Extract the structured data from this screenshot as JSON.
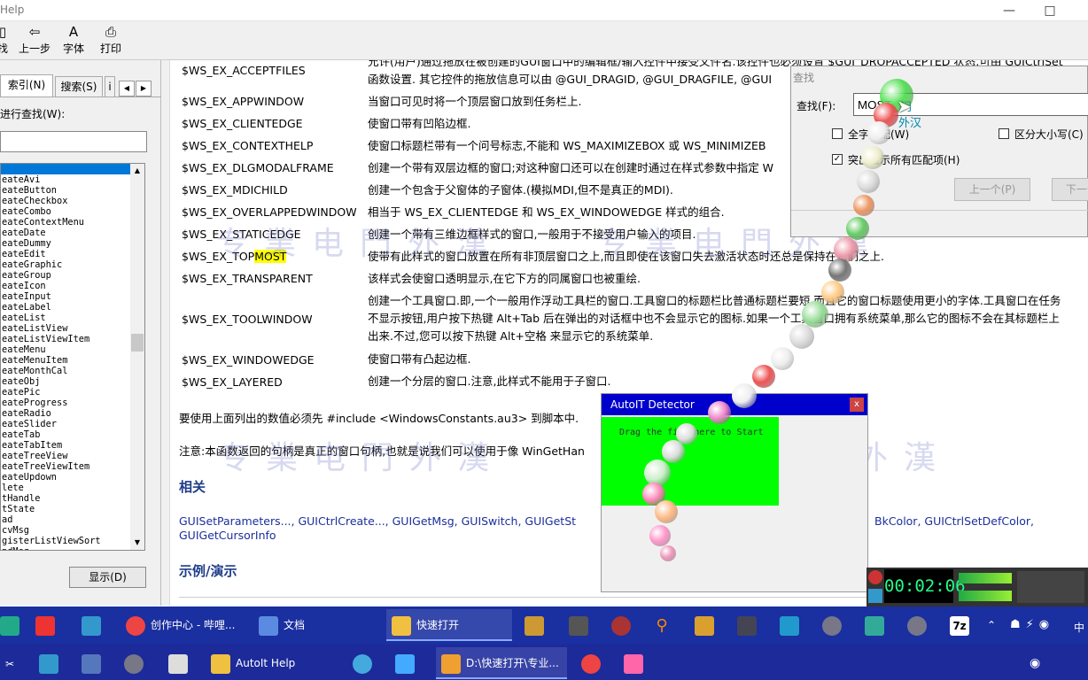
{
  "window": {
    "title": "Help",
    "minimize": "—",
    "maximize": "□"
  },
  "toolbar": {
    "buttons": [
      {
        "label": "找",
        "icon": "locate-icon"
      },
      {
        "label": "上一步",
        "icon": "back-icon"
      },
      {
        "label": "字体",
        "icon": "font-icon"
      },
      {
        "label": "打印",
        "icon": "print-icon"
      }
    ]
  },
  "sidebar": {
    "tab_index": "索引(N)",
    "tab_search": "搜索(S)",
    "tab_more": "i",
    "search_label": "进行查找(W):",
    "search_value": "",
    "items": [
      "eateAvi",
      "eateButton",
      "eateCheckbox",
      "eateCombo",
      "eateContextMenu",
      "eateDate",
      "eateDummy",
      "eateEdit",
      "eateGraphic",
      "eateGroup",
      "eateIcon",
      "eateInput",
      "eateLabel",
      "eateList",
      "eateListView",
      "eateListViewItem",
      "eateMenu",
      "eateMenuItem",
      "eateMonthCal",
      "eateObj",
      "eatePic",
      "eateProgress",
      "eateRadio",
      "eateSlider",
      "eateTab",
      "eateTabItem",
      "eateTreeView",
      "eateTreeViewItem",
      "eateUpdown",
      "lete",
      "tHandle",
      "tState",
      "ad",
      "cvMsg",
      "gisterListViewSort",
      "ndMsg"
    ],
    "display_button": "显示(D)"
  },
  "content": {
    "rows": [
      {
        "name": "$WS_EX_ACCEPTFILES",
        "desc": "允许(用户)通过拖放在被创建的GUI窗口中的编辑框/输入控件中接受文件名.该控件也必须设置 $GUI_DROPACCEPTED 状态.可由 GUICtrlSet",
        "desc2": "函数设置. 其它控件的拖放信息可以由 @GUI_DRAGID, @GUI_DRAGFILE, @GUI"
      },
      {
        "name": "$WS_EX_APPWINDOW",
        "desc": "当窗口可见时将一个顶层窗口放到任务栏上."
      },
      {
        "name": "$WS_EX_CLIENTEDGE",
        "desc": "使窗口带有凹陷边框."
      },
      {
        "name": "$WS_EX_CONTEXTHELP",
        "desc": "使窗口标题栏带有一个问号标志,不能和 WS_MAXIMIZEBOX 或 WS_MINIMIZEB"
      },
      {
        "name": "$WS_EX_DLGMODALFRAME",
        "desc": "创建一个带有双层边框的窗口;对这种窗口还可以在创建时通过在样式参数中指定 W"
      },
      {
        "name": "$WS_EX_MDICHILD",
        "desc": "创建一个包含于父窗体的子窗体.(模拟MDI,但不是真正的MDI)."
      },
      {
        "name": "$WS_EX_OVERLAPPEDWINDOW",
        "desc": "相当于 WS_EX_CLIENTEDGE 和 WS_EX_WINDOWEDGE 样式的组合."
      },
      {
        "name": "$WS_EX_STATICEDGE",
        "desc": "创建一个带有三维边框样式的窗口,一般用于不接受用户输入的项目."
      },
      {
        "name_a": "$WS_EX_TOP",
        "name_b": "MOST",
        "desc": "使带有此样式的窗口放置在所有非顶层窗口之上,而且即使在该窗口失去激活状态时还总是保持在它们之上."
      },
      {
        "name": "$WS_EX_TRANSPARENT",
        "desc": "该样式会使窗口透明显示,在它下方的同属窗口也被重绘."
      },
      {
        "name": "$WS_EX_TOOLWINDOW",
        "desc": "创建一个工具窗口.即,一个一般用作浮动工具栏的窗口.工具窗口的标题栏比普通标题栏要短,而且它的窗口标题使用更小的字体.工具窗口在任务",
        "desc2": "不显示按钮,用户按下热键 Alt+Tab 后在弹出的对话框中也不会显示它的图标.如果一个工具窗口拥有系统菜单,那么它的图标不会在其标题栏上",
        "desc3": "出来.不过,您可以按下热键 Alt+空格 来显示它的系统菜单."
      },
      {
        "name": "$WS_EX_WINDOWEDGE",
        "desc": "使窗口带有凸起边框."
      },
      {
        "name": "$WS_EX_LAYERED",
        "desc": "创建一个分层的窗口.注意,此样式不能用于子窗口."
      }
    ],
    "include_note": "要使用上面列出的数值必须先 #include <WindowsConstants.au3> 到脚本中.",
    "handle_note": "注意:本函数返回的句柄是真正的窗口句柄,也就是说我们可以使用于像 WinGetHan",
    "related_heading": "相关",
    "related_links": "GUISetParameters..., GUICtrlCreate..., GUIGetMsg, GUISwitch, GUIGetSt",
    "related_links_right": "BkColor, GUICtrlSetDefColor,",
    "related_links2": "GUIGetCursorInfo",
    "example_heading": "示例/演示"
  },
  "find_dialog": {
    "title": "查找",
    "label": "查找(F):",
    "value": "MOST",
    "whole_word": "全字匹配(W)",
    "match_case": "区分大小写(C)",
    "highlight_all": "突出显示所有匹配项(H)",
    "prev": "上一个(P)",
    "next": "下一个(N)",
    "ime_hint_1": "门",
    "ime_hint_2": "外汉"
  },
  "detector": {
    "title": "AutoIT Detector",
    "close": "x",
    "hint": "Drag the file here to Start"
  },
  "recorder": {
    "time": "00:02:06"
  },
  "watermark": "专業电門外漢",
  "taskbar_top": [
    {
      "label": "创作中心 - 哔哩...",
      "icon": "chrome-icon",
      "color": "#e44"
    },
    {
      "label": "文档",
      "icon": "document-icon",
      "color": "#5a8be0"
    },
    {
      "label": "快速打开",
      "icon": "folder-icon",
      "color": "#f0c040"
    }
  ],
  "taskbar_bottom": [
    {
      "label": "AutoIt Help",
      "icon": "help-icon",
      "color": "#f0c040"
    },
    {
      "label": "D:\\快速打开\\专业...",
      "icon": "folder-icon",
      "color": "#f0a030"
    }
  ],
  "tray": {
    "ime": "中",
    "seven_zip": "7z"
  },
  "colors": {
    "taskbar": "#1a2fa0",
    "accent": "#0078d7",
    "highlight": "#ffff00",
    "detector_title": "#0000cc",
    "detector_canvas": "#00ff00"
  }
}
